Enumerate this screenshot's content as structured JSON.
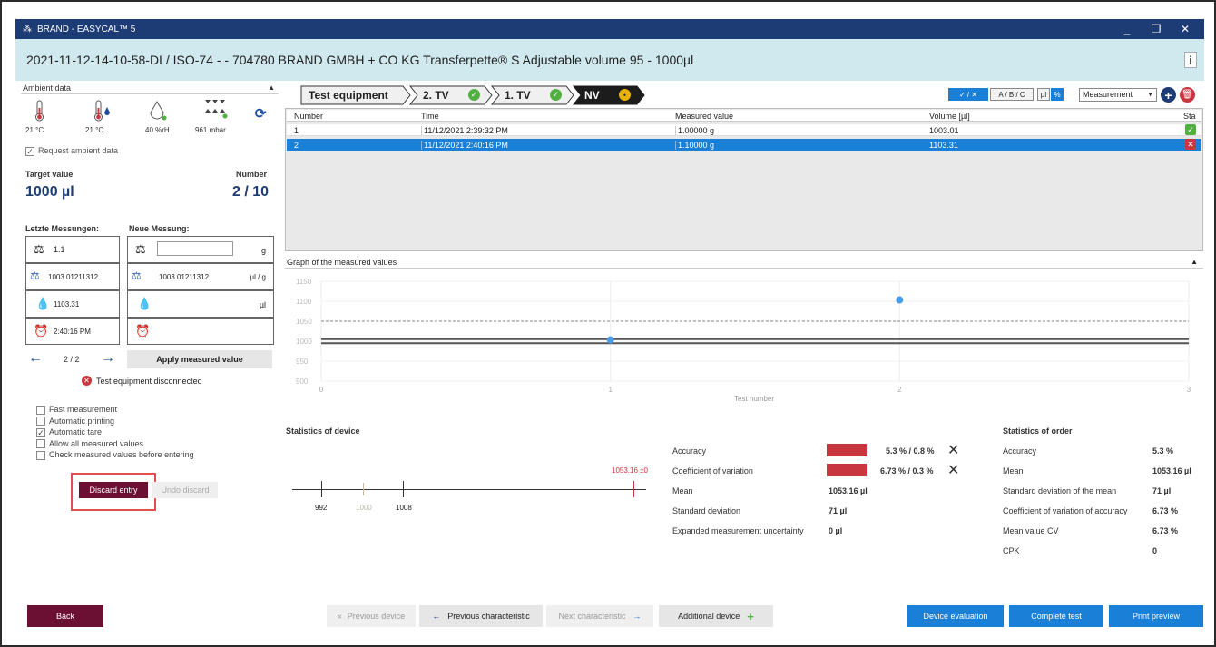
{
  "window": {
    "title": "BRAND - EASYCAL™ 5",
    "minimize": "_",
    "maximize": "❐",
    "close": "✕"
  },
  "header": {
    "title": "2021-11-12-14-10-58-DI / ISO-74 -  - 704780 BRAND GMBH + CO KG Transferpette® S Adjustable volume 95 - 1000µl",
    "info": "i"
  },
  "ambient": {
    "section_label": "Ambient data",
    "temp1": "21 °C",
    "temp2": "21 °C",
    "humidity": "40 %rH",
    "pressure": "961 mbar",
    "request_label": "Request ambient data"
  },
  "target": {
    "label": "Target value",
    "value": "1000 µl",
    "number_label": "Number",
    "number_value": "2 / 10"
  },
  "measurements": {
    "last_label": "Letzte Messungen:",
    "new_label": "Neue Messung:",
    "last_weight": "1.1",
    "last_z": "1003.01211312",
    "last_volume": "1103.31",
    "last_time": "2:40:16 PM",
    "new_weight": "",
    "new_weight_unit": "g",
    "new_z": "1003.01211312",
    "new_z_unit": "µl / g",
    "new_volume_unit": "µl",
    "nav_counter": "2 / 2",
    "apply_button": "Apply measured value",
    "disconnected": "Test equipment disconnected"
  },
  "options": {
    "fast": "Fast measurement",
    "printing": "Automatic printing",
    "tare": "Automatic tare",
    "allow_all": "Allow all measured values",
    "check": "Check measured values before entering",
    "discard": "Discard entry",
    "undo": "Undo discard"
  },
  "breadcrumb": {
    "test_equipment": "Test equipment",
    "tv2": "2. TV",
    "tv1": "1. TV",
    "nv": "NV"
  },
  "toolbar": {
    "check_x": "✓ / ✕",
    "abc": "A / B / C",
    "ul": "µl",
    "percent": "%",
    "mode_select": "Measurement"
  },
  "table": {
    "headers": [
      "Number",
      "Time",
      "Measured value",
      "Volume [µl]",
      "Sta"
    ],
    "rows": [
      {
        "number": "1",
        "time": "11/12/2021 2:39:32 PM",
        "measured": "1.00000 g",
        "volume": "1003.01"
      },
      {
        "number": "2",
        "time": "11/12/2021 2:40:16 PM",
        "measured": "1.10000 g",
        "volume": "1103.31"
      }
    ]
  },
  "graph": {
    "title": "Graph of the measured values",
    "xlabel": "Test number"
  },
  "chart_data": {
    "type": "scatter",
    "title": "Graph of the measured values",
    "xlabel": "Test number",
    "ylabel": "",
    "x_ticks": [
      "0",
      "1",
      "2",
      "3"
    ],
    "y_ticks": [
      "1150",
      "1100",
      "1050",
      "1000",
      "950",
      "900"
    ],
    "xlim": [
      0,
      3
    ],
    "ylim": [
      900,
      1150
    ],
    "points": [
      {
        "x": 1,
        "y": 1003.01
      },
      {
        "x": 2,
        "y": 1103.31
      }
    ],
    "reference_lines": [
      1000,
      1050
    ],
    "band_lines": [
      995,
      1005
    ]
  },
  "stats_device": {
    "title": "Statistics of device",
    "mean_marker": "1053.16 ±0",
    "scale_992": "992",
    "scale_1000": "1000",
    "scale_1008": "1008",
    "accuracy_label": "Accuracy",
    "accuracy_value": "5.3 % / 0.8 %",
    "cv_label": "Coefficient of variation",
    "cv_value": "6.73 % / 0.3 %",
    "mean_label": "Mean",
    "mean_value": "1053.16 µl",
    "sd_label": "Standard deviation",
    "sd_value": "71 µl",
    "emu_label": "Expanded measurement uncertainty",
    "emu_value": "0 µl"
  },
  "stats_order": {
    "title": "Statistics of order",
    "rows": [
      {
        "label": "Accuracy",
        "value": "5.3 %"
      },
      {
        "label": "Mean",
        "value": "1053.16 µl"
      },
      {
        "label": "Standard deviation of the mean",
        "value": "71 µl"
      },
      {
        "label": "Coefficient of variation of accuracy",
        "value": "6.73 %"
      },
      {
        "label": "Mean value CV",
        "value": "6.73 %"
      },
      {
        "label": "CPK",
        "value": "0"
      }
    ]
  },
  "footer": {
    "back": "Back",
    "prev_device": "Previous device",
    "prev_char": "Previous characteristic",
    "next_char": "Next characteristic",
    "additional": "Additional device",
    "device_eval": "Device evaluation",
    "complete": "Complete test",
    "print": "Print preview"
  },
  "colors": {
    "titlebar": "#1d3b74",
    "header": "#cfe9ee",
    "accent_blue": "#1a7fd6",
    "maroon": "#6b0f33",
    "fail_red": "#c8373f",
    "ok_green": "#52b043"
  }
}
